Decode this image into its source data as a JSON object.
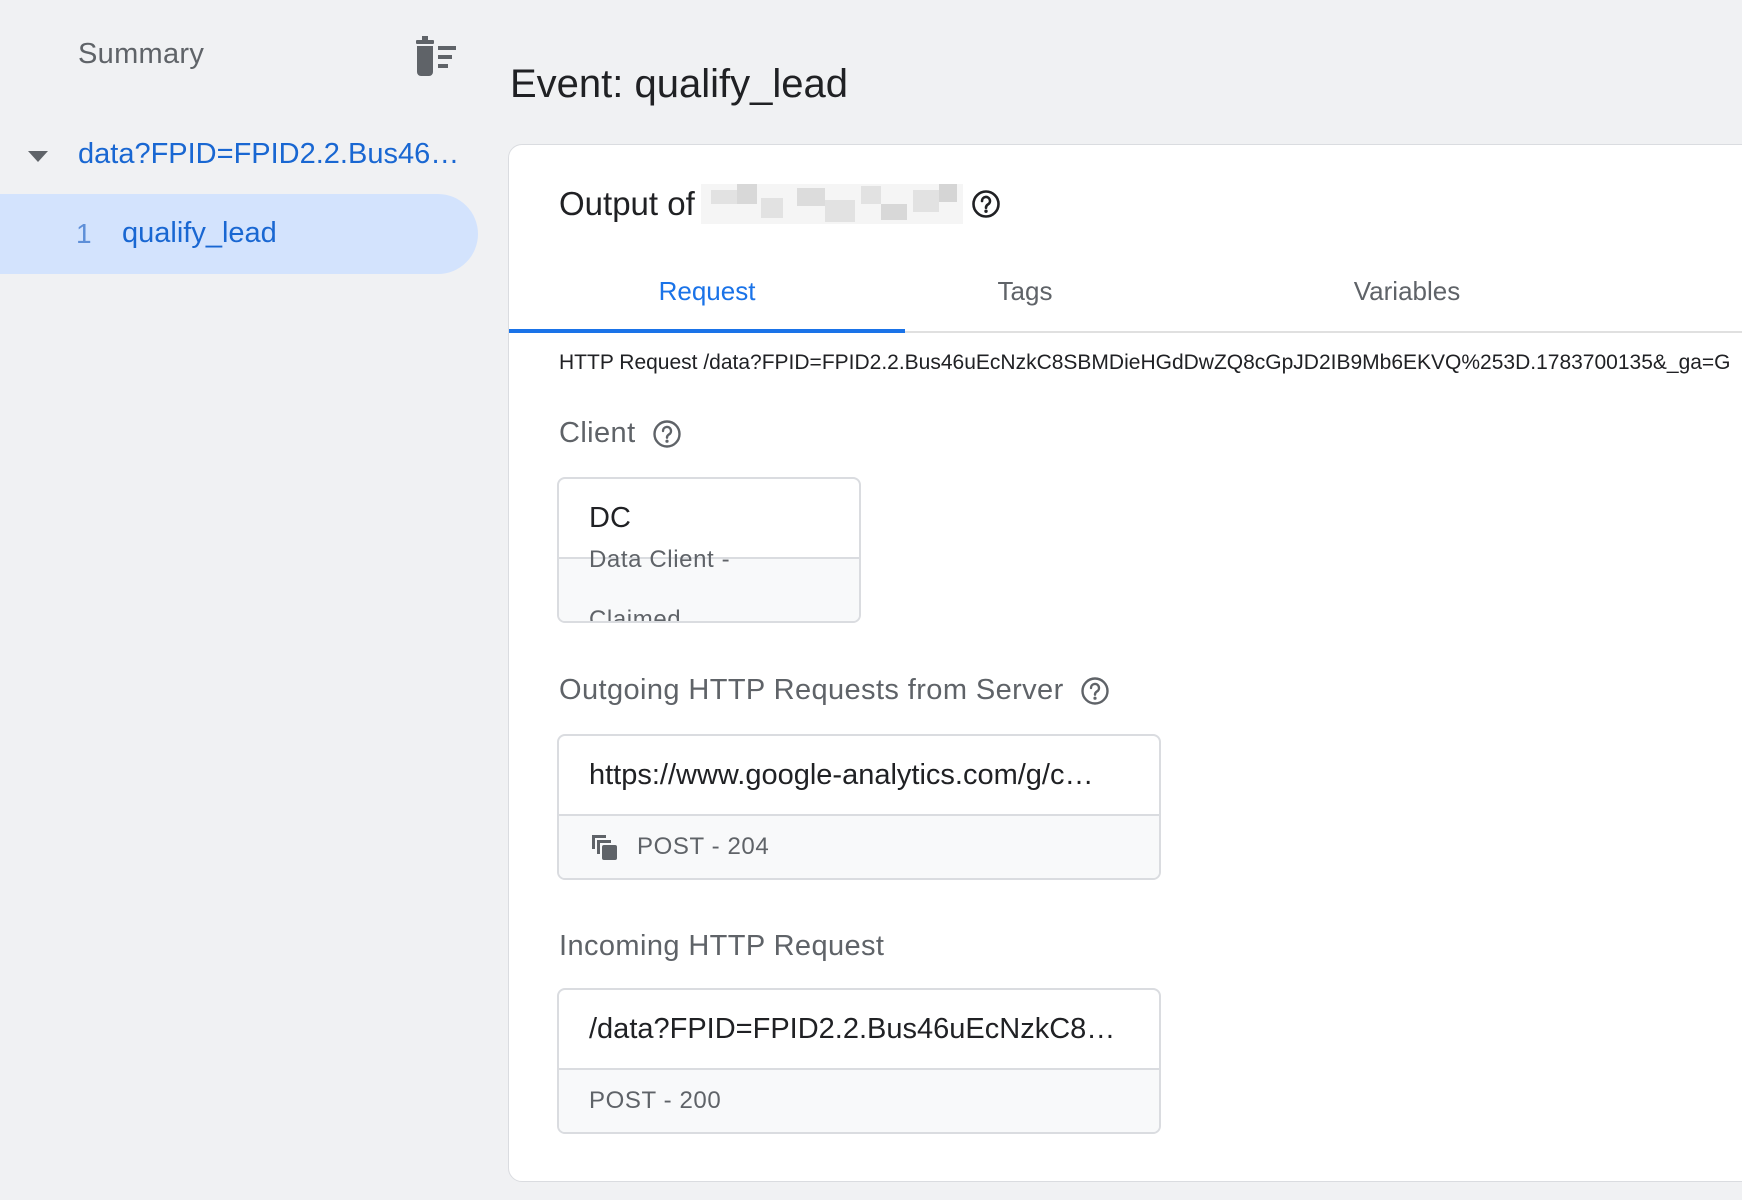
{
  "sidebar": {
    "header": "Summary",
    "clear_icon": "delete-sweep-icon",
    "parent": {
      "label": "data?FPID=FPID2.2.Bus46u…",
      "expanded": true
    },
    "child": {
      "index": "1",
      "label": "qualify_lead",
      "selected": true
    }
  },
  "main": {
    "title": "Event: qualify_lead",
    "output_label": "Output of",
    "tabs": [
      {
        "label": "Request",
        "active": true
      },
      {
        "label": "Tags",
        "active": false
      },
      {
        "label": "Variables",
        "active": false
      }
    ],
    "http_request": "HTTP Request /data?FPID=FPID2.2.Bus46uEcNzkC8SBMDieHGdDwZQ8cGpJD2IB9Mb6EKVQ%253D.1783700135&_ga=G",
    "client": {
      "heading": "Client",
      "name": "DC",
      "status": "Data Client - Claimed"
    },
    "outgoing": {
      "heading": "Outgoing HTTP Requests from Server",
      "url": "https://www.google-analytics.com/g/c…",
      "status": "POST - 204"
    },
    "incoming": {
      "heading": "Incoming HTTP Request",
      "url": "/data?FPID=FPID2.2.Bus46uEcNzkC8…",
      "status": "POST - 200"
    }
  },
  "colors": {
    "accent": "#1a73e8",
    "selected_bg": "#d3e3fd",
    "background": "#f0f1f3"
  }
}
